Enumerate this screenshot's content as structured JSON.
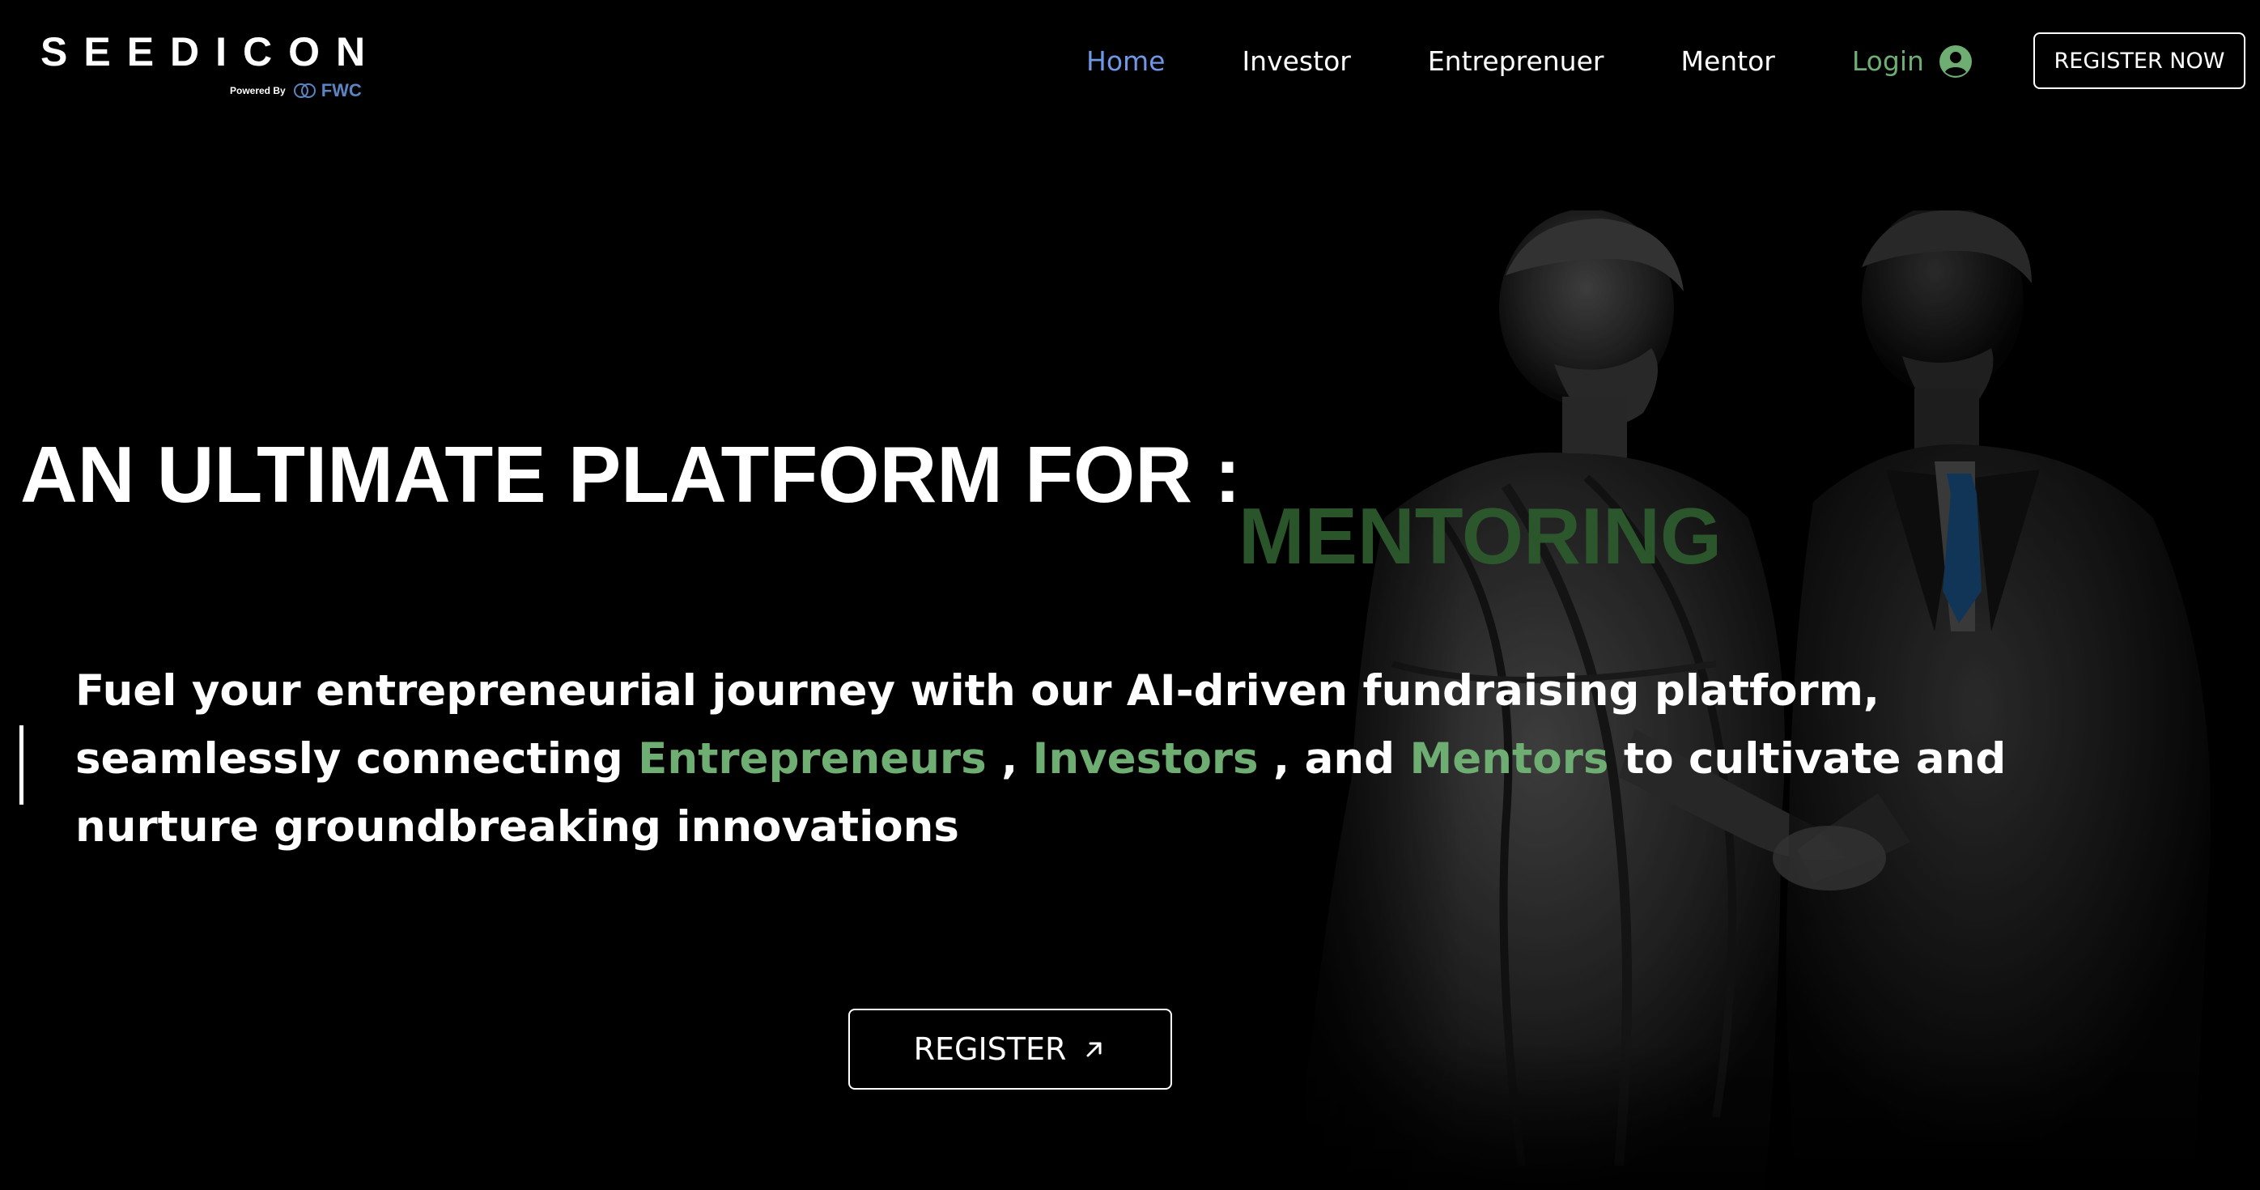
{
  "brand": {
    "name": "SEEDICON",
    "powered_by": "Powered By",
    "partner": "FWC"
  },
  "nav": {
    "items": [
      {
        "label": "Home",
        "active": true
      },
      {
        "label": "Investor",
        "active": false
      },
      {
        "label": "Entreprenuer",
        "active": false
      },
      {
        "label": "Mentor",
        "active": false
      }
    ],
    "login_label": "Login",
    "register_now_label": "REGISTER NOW"
  },
  "hero": {
    "headline": "AN ULTIMATE PLATFORM FOR :",
    "rotating_word": "MENTORING",
    "description": {
      "part1": "Fuel your entrepreneurial journey with our AI-driven fundraising platform, seamlessly connecting ",
      "entrepreneurs": "Entrepreneurs",
      "sep1": " , ",
      "investors": "Investors",
      "sep2": " , and ",
      "mentors": "Mentors",
      "part2": " to cultivate and nurture groundbreaking innovations"
    },
    "cta_label": "REGISTER"
  },
  "colors": {
    "background": "#000000",
    "nav_active": "#6e97e6",
    "accent_green": "#6fae72",
    "rotating_word": "#2d5a2e",
    "fwc_blue": "#5b84c4"
  },
  "icons": {
    "login": "user-circle-icon",
    "cta": "arrow-up-right-icon",
    "partner": "fwc-rings-icon"
  }
}
